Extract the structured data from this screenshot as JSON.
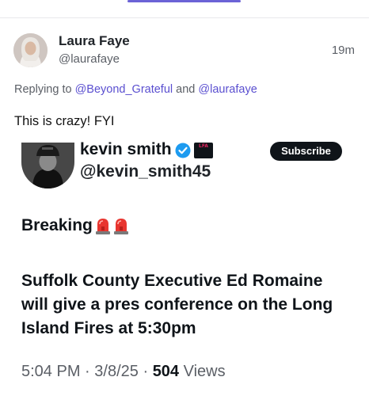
{
  "reply": {
    "author": {
      "name": "Laura Faye",
      "handle": "@laurafaye",
      "time": "19m"
    },
    "replying": {
      "prefix": "Replying to",
      "mention1": "@Beyond_Grateful",
      "conj": "and",
      "mention2": "@laurafaye"
    },
    "text": "This is crazy! FYI"
  },
  "embed": {
    "author": {
      "name": "kevin smith",
      "handle": "@kevin_smith45",
      "badge": "LFA"
    },
    "subscribe_label": "Subscribe",
    "breaking": "Breaking",
    "headline": "Suffolk County Executive Ed Romaine will give a pres conference on the Long Island Fires at 5:30pm",
    "meta": {
      "time": "5:04 PM",
      "sep1": "·",
      "date": "3/8/25",
      "sep2": "·",
      "views_count": "504",
      "views_label": "Views"
    }
  },
  "colors": {
    "accent": "#6b63d6",
    "mention": "#5a4fd0",
    "verified": "#1d9bf0"
  }
}
